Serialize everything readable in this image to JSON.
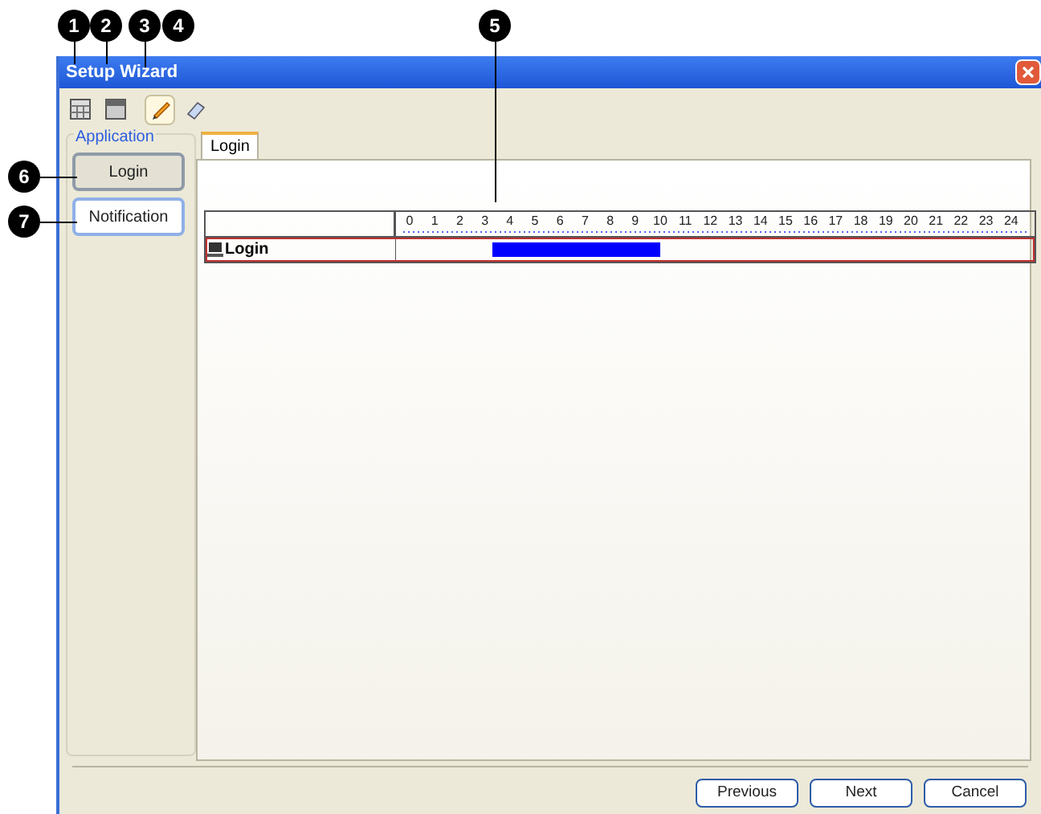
{
  "callouts": [
    "1",
    "2",
    "3",
    "4",
    "5",
    "6",
    "7"
  ],
  "window": {
    "title": "Setup Wizard"
  },
  "toolbar": [
    {
      "kind": "grid",
      "selected": false
    },
    {
      "kind": "calendar",
      "selected": false
    },
    {
      "kind": "pencil",
      "selected": true
    },
    {
      "kind": "eraser",
      "selected": false
    }
  ],
  "sidebar": {
    "group_label": "Application",
    "items": [
      {
        "label": "Login",
        "selected": true
      },
      {
        "label": "Notification",
        "selected": false
      }
    ]
  },
  "tabs": [
    {
      "label": "Login",
      "selected": true
    }
  ],
  "timeline": {
    "hours": [
      "0",
      "1",
      "2",
      "3",
      "4",
      "5",
      "6",
      "7",
      "8",
      "9",
      "10",
      "11",
      "12",
      "13",
      "14",
      "15",
      "16",
      "17",
      "18",
      "19",
      "20",
      "21",
      "22",
      "23",
      "24"
    ],
    "rows": [
      {
        "label": "Login",
        "selected": true
      }
    ]
  },
  "buttons": [
    "Previous",
    "Next",
    "Cancel"
  ]
}
